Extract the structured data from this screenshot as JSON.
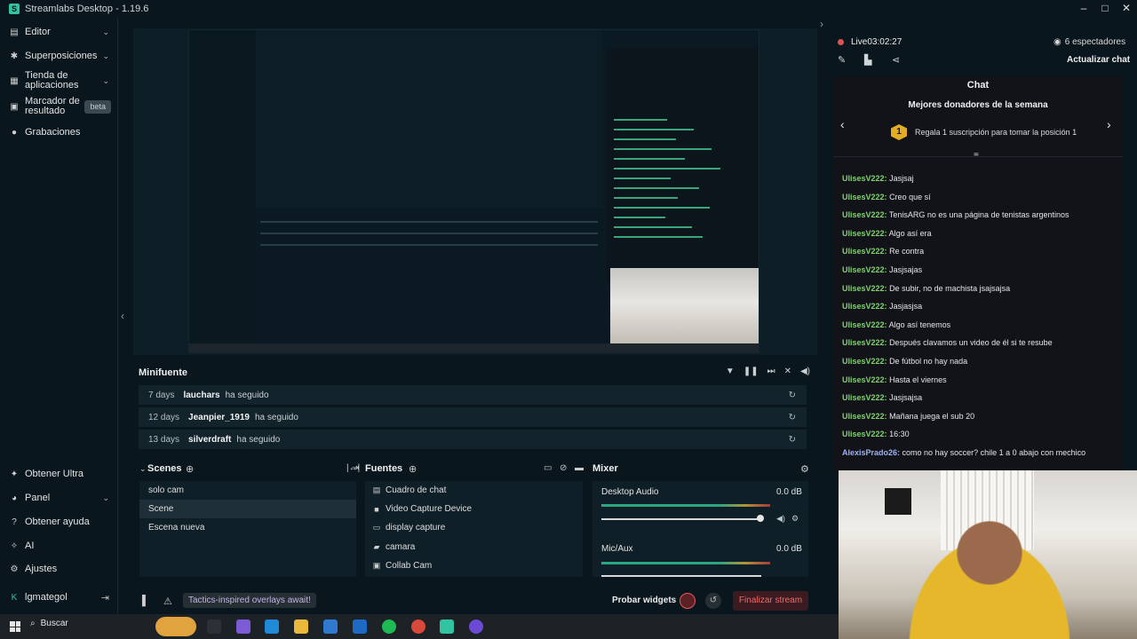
{
  "titlebar": {
    "title": "Streamlabs Desktop - 1.19.6"
  },
  "nav": {
    "top": [
      {
        "label": "Editor"
      },
      {
        "label": "Superposiciones"
      },
      {
        "label": "Tienda de aplicaciones"
      },
      {
        "label": "Marcador de resultado",
        "badge": "beta"
      },
      {
        "label": "Grabaciones"
      }
    ],
    "bottom": [
      {
        "label": "Obtener Ultra"
      },
      {
        "label": "Panel"
      },
      {
        "label": "Obtener ayuda"
      },
      {
        "label": "AI"
      },
      {
        "label": "Ajustes"
      },
      {
        "label": "lgmategol"
      }
    ]
  },
  "minifeed": {
    "title": "Minifuente",
    "rows": [
      {
        "days": "7 days",
        "name": "lauchars",
        "action": "ha seguido"
      },
      {
        "days": "12 days",
        "name": "Jeanpier_1919",
        "action": "ha seguido"
      },
      {
        "days": "13 days",
        "name": "silverdraft",
        "action": "ha seguido"
      }
    ]
  },
  "scenes": {
    "title": "Scenes",
    "items": [
      {
        "label": "solo cam"
      },
      {
        "label": "Scene"
      },
      {
        "label": "Escena nueva"
      }
    ]
  },
  "sources": {
    "title": "Fuentes",
    "items": [
      {
        "label": "Cuadro de chat"
      },
      {
        "label": "Video Capture Device"
      },
      {
        "label": "display capture"
      },
      {
        "label": "camara"
      },
      {
        "label": "Collab Cam"
      }
    ]
  },
  "mixer": {
    "title": "Mixer",
    "channels": [
      {
        "label": "Desktop Audio",
        "db": "0.0 dB"
      },
      {
        "label": "Mic/Aux",
        "db": "0.0 dB"
      }
    ]
  },
  "bottombar": {
    "promo": "Tactics-inspired overlays await!",
    "test_widgets": "Probar widgets",
    "end_stream": "Finalizar stream"
  },
  "live": {
    "status": "Live",
    "time": "03:02:27",
    "viewers": "6 espectadores",
    "refresh_chat": "Actualizar chat"
  },
  "chat": {
    "title": "Chat",
    "top_donors_title": "Mejores donadores de la semana",
    "donor_prompt": "Regala 1 suscripción para tomar la posición 1",
    "donor_rank": "1",
    "messages": [
      {
        "user": "UlisesV222:",
        "text": "Jasjsaj"
      },
      {
        "user": "UlisesV222:",
        "text": "Creo que sí"
      },
      {
        "user": "UlisesV222:",
        "text": "TenisARG no es una página de tenistas argentinos"
      },
      {
        "user": "UlisesV222:",
        "text": "Algo así era"
      },
      {
        "user": "UlisesV222:",
        "text": "Re contra"
      },
      {
        "user": "UlisesV222:",
        "text": "Jasjsajas"
      },
      {
        "user": "UlisesV222:",
        "text": "De subir, no de machista jsajsajsa"
      },
      {
        "user": "UlisesV222:",
        "text": "Jasjasjsa"
      },
      {
        "user": "UlisesV222:",
        "text": "Algo así tenemos"
      },
      {
        "user": "UlisesV222:",
        "text": "Después clavamos un video de él si te resube"
      },
      {
        "user": "UlisesV222:",
        "text": "De fútbol no hay nada"
      },
      {
        "user": "UlisesV222:",
        "text": "Hasta el viernes"
      },
      {
        "user": "UlisesV222:",
        "text": "Jasjsajsa"
      },
      {
        "user": "UlisesV222:",
        "text": "Mañana juega el sub 20"
      },
      {
        "user": "UlisesV222:",
        "text": "16:30"
      },
      {
        "user": "AlexisPrado26:",
        "text": "como no hay soccer? chile 1 a 0 abajo con mechico"
      }
    ]
  },
  "taskbar": {
    "search": "Buscar"
  },
  "colors": {
    "accent": "#31c3a2",
    "live": "#e05252",
    "end": "#ef6a6e",
    "chat_user": "#7fd36b"
  }
}
